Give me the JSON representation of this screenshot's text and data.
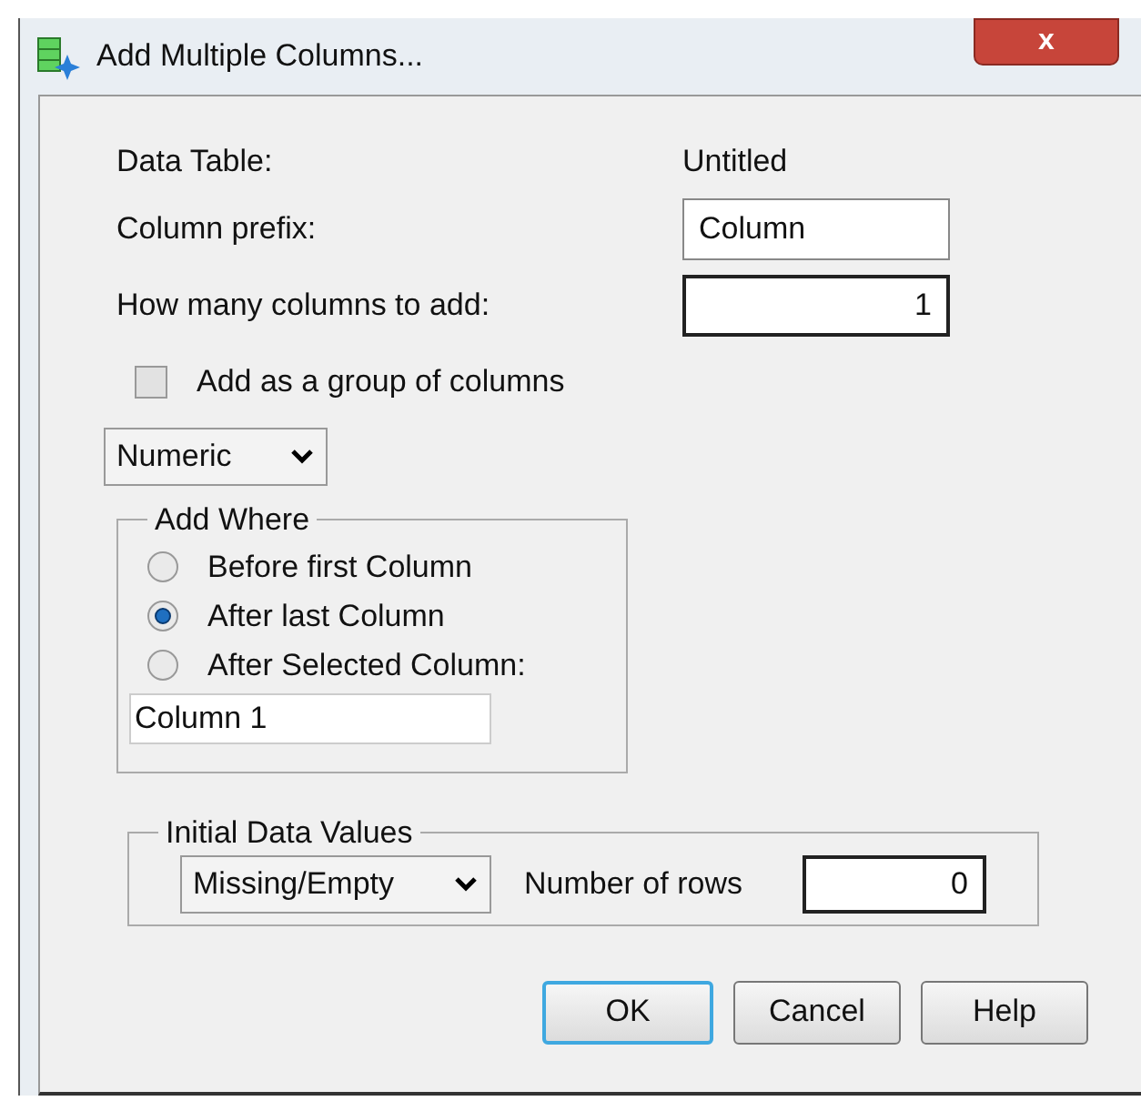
{
  "window": {
    "title": "Add Multiple Columns...",
    "close_label": "x"
  },
  "data_table": {
    "label": "Data Table:",
    "value": "Untitled"
  },
  "column_prefix": {
    "label": "Column prefix:",
    "value": "Column"
  },
  "column_count": {
    "label": "How many columns to add:",
    "value": "1"
  },
  "group_checkbox": {
    "label": "Add as a group of columns",
    "checked": false
  },
  "type_select": {
    "value": "Numeric"
  },
  "add_where": {
    "title": "Add Where",
    "options": [
      {
        "label": "Before first Column",
        "selected": false
      },
      {
        "label": "After last Column",
        "selected": true
      },
      {
        "label": "After Selected Column:",
        "selected": false
      }
    ],
    "selected_column": "Column 1"
  },
  "initial_values": {
    "title": "Initial Data Values",
    "select_value": "Missing/Empty",
    "rows_label": "Number of rows",
    "rows_value": "0"
  },
  "buttons": [
    {
      "label": "OK",
      "default": true
    },
    {
      "label": "Cancel",
      "default": false
    },
    {
      "label": "Help",
      "default": false
    }
  ]
}
